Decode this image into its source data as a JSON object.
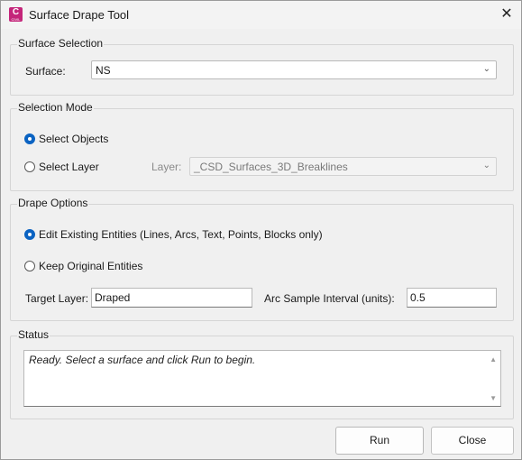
{
  "window": {
    "title": "Surface Drape Tool",
    "app_icon_letter": "C",
    "app_icon_sub": "CIVIL",
    "close_glyph": "✕"
  },
  "surface_selection": {
    "group_title": "Surface Selection",
    "surface_label": "Surface:",
    "surface_value": "NS"
  },
  "selection_mode": {
    "group_title": "Selection Mode",
    "options": [
      {
        "label": "Select Objects",
        "selected": true
      },
      {
        "label": "Select Layer",
        "selected": false
      }
    ],
    "layer_label": "Layer:",
    "layer_value": "_CSD_Surfaces_3D_Breaklines"
  },
  "drape_options": {
    "group_title": "Drape Options",
    "options": [
      {
        "label": "Edit Existing Entities (Lines, Arcs, Text, Points, Blocks only)",
        "selected": true
      },
      {
        "label": "Keep Original Entities",
        "selected": false
      }
    ],
    "target_layer_label": "Target Layer:",
    "target_layer_value": "Draped",
    "arc_interval_label": "Arc Sample Interval (units):",
    "arc_interval_value": "0.5"
  },
  "status": {
    "group_title": "Status",
    "text": "Ready. Select a surface and click Run to begin."
  },
  "buttons": {
    "run": "Run",
    "close": "Close"
  },
  "colors": {
    "accent": "#0b63c2",
    "app_icon": "#c4257a"
  }
}
